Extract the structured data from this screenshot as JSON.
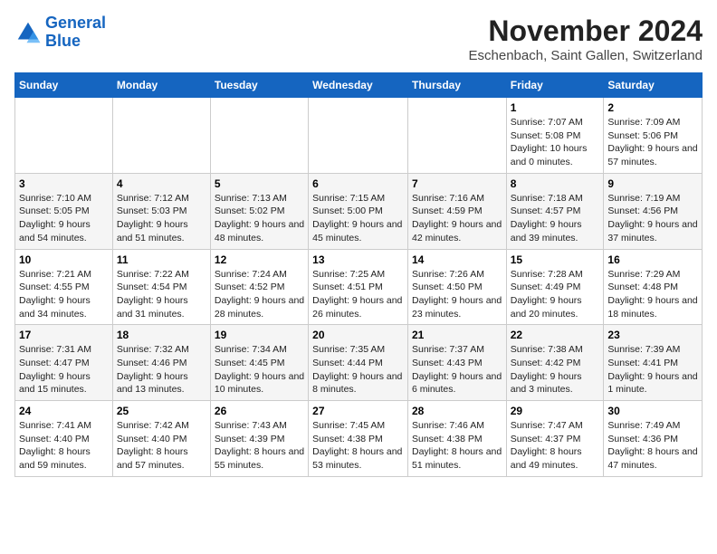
{
  "logo": {
    "line1": "General",
    "line2": "Blue"
  },
  "title": "November 2024",
  "subtitle": "Eschenbach, Saint Gallen, Switzerland",
  "weekdays": [
    "Sunday",
    "Monday",
    "Tuesday",
    "Wednesday",
    "Thursday",
    "Friday",
    "Saturday"
  ],
  "weeks": [
    [
      {
        "day": "",
        "info": ""
      },
      {
        "day": "",
        "info": ""
      },
      {
        "day": "",
        "info": ""
      },
      {
        "day": "",
        "info": ""
      },
      {
        "day": "",
        "info": ""
      },
      {
        "day": "1",
        "info": "Sunrise: 7:07 AM\nSunset: 5:08 PM\nDaylight: 10 hours and 0 minutes."
      },
      {
        "day": "2",
        "info": "Sunrise: 7:09 AM\nSunset: 5:06 PM\nDaylight: 9 hours and 57 minutes."
      }
    ],
    [
      {
        "day": "3",
        "info": "Sunrise: 7:10 AM\nSunset: 5:05 PM\nDaylight: 9 hours and 54 minutes."
      },
      {
        "day": "4",
        "info": "Sunrise: 7:12 AM\nSunset: 5:03 PM\nDaylight: 9 hours and 51 minutes."
      },
      {
        "day": "5",
        "info": "Sunrise: 7:13 AM\nSunset: 5:02 PM\nDaylight: 9 hours and 48 minutes."
      },
      {
        "day": "6",
        "info": "Sunrise: 7:15 AM\nSunset: 5:00 PM\nDaylight: 9 hours and 45 minutes."
      },
      {
        "day": "7",
        "info": "Sunrise: 7:16 AM\nSunset: 4:59 PM\nDaylight: 9 hours and 42 minutes."
      },
      {
        "day": "8",
        "info": "Sunrise: 7:18 AM\nSunset: 4:57 PM\nDaylight: 9 hours and 39 minutes."
      },
      {
        "day": "9",
        "info": "Sunrise: 7:19 AM\nSunset: 4:56 PM\nDaylight: 9 hours and 37 minutes."
      }
    ],
    [
      {
        "day": "10",
        "info": "Sunrise: 7:21 AM\nSunset: 4:55 PM\nDaylight: 9 hours and 34 minutes."
      },
      {
        "day": "11",
        "info": "Sunrise: 7:22 AM\nSunset: 4:54 PM\nDaylight: 9 hours and 31 minutes."
      },
      {
        "day": "12",
        "info": "Sunrise: 7:24 AM\nSunset: 4:52 PM\nDaylight: 9 hours and 28 minutes."
      },
      {
        "day": "13",
        "info": "Sunrise: 7:25 AM\nSunset: 4:51 PM\nDaylight: 9 hours and 26 minutes."
      },
      {
        "day": "14",
        "info": "Sunrise: 7:26 AM\nSunset: 4:50 PM\nDaylight: 9 hours and 23 minutes."
      },
      {
        "day": "15",
        "info": "Sunrise: 7:28 AM\nSunset: 4:49 PM\nDaylight: 9 hours and 20 minutes."
      },
      {
        "day": "16",
        "info": "Sunrise: 7:29 AM\nSunset: 4:48 PM\nDaylight: 9 hours and 18 minutes."
      }
    ],
    [
      {
        "day": "17",
        "info": "Sunrise: 7:31 AM\nSunset: 4:47 PM\nDaylight: 9 hours and 15 minutes."
      },
      {
        "day": "18",
        "info": "Sunrise: 7:32 AM\nSunset: 4:46 PM\nDaylight: 9 hours and 13 minutes."
      },
      {
        "day": "19",
        "info": "Sunrise: 7:34 AM\nSunset: 4:45 PM\nDaylight: 9 hours and 10 minutes."
      },
      {
        "day": "20",
        "info": "Sunrise: 7:35 AM\nSunset: 4:44 PM\nDaylight: 9 hours and 8 minutes."
      },
      {
        "day": "21",
        "info": "Sunrise: 7:37 AM\nSunset: 4:43 PM\nDaylight: 9 hours and 6 minutes."
      },
      {
        "day": "22",
        "info": "Sunrise: 7:38 AM\nSunset: 4:42 PM\nDaylight: 9 hours and 3 minutes."
      },
      {
        "day": "23",
        "info": "Sunrise: 7:39 AM\nSunset: 4:41 PM\nDaylight: 9 hours and 1 minute."
      }
    ],
    [
      {
        "day": "24",
        "info": "Sunrise: 7:41 AM\nSunset: 4:40 PM\nDaylight: 8 hours and 59 minutes."
      },
      {
        "day": "25",
        "info": "Sunrise: 7:42 AM\nSunset: 4:40 PM\nDaylight: 8 hours and 57 minutes."
      },
      {
        "day": "26",
        "info": "Sunrise: 7:43 AM\nSunset: 4:39 PM\nDaylight: 8 hours and 55 minutes."
      },
      {
        "day": "27",
        "info": "Sunrise: 7:45 AM\nSunset: 4:38 PM\nDaylight: 8 hours and 53 minutes."
      },
      {
        "day": "28",
        "info": "Sunrise: 7:46 AM\nSunset: 4:38 PM\nDaylight: 8 hours and 51 minutes."
      },
      {
        "day": "29",
        "info": "Sunrise: 7:47 AM\nSunset: 4:37 PM\nDaylight: 8 hours and 49 minutes."
      },
      {
        "day": "30",
        "info": "Sunrise: 7:49 AM\nSunset: 4:36 PM\nDaylight: 8 hours and 47 minutes."
      }
    ]
  ]
}
